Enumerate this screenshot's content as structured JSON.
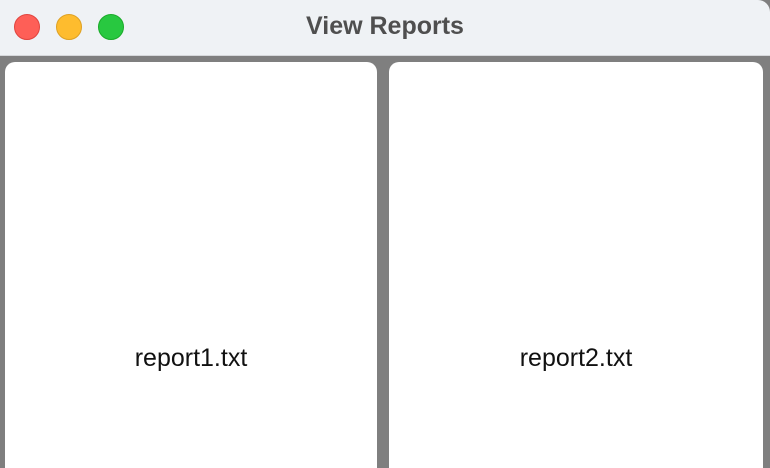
{
  "window": {
    "title": "View Reports"
  },
  "reports": [
    {
      "filename": "report1.txt"
    },
    {
      "filename": "report2.txt"
    }
  ],
  "colors": {
    "close": "#fe5f57",
    "minimize": "#febc2e",
    "zoom": "#28c840",
    "titlebar_bg": "#eff2f5",
    "content_bg": "#7f7f7f",
    "panel_bg": "#ffffff"
  }
}
